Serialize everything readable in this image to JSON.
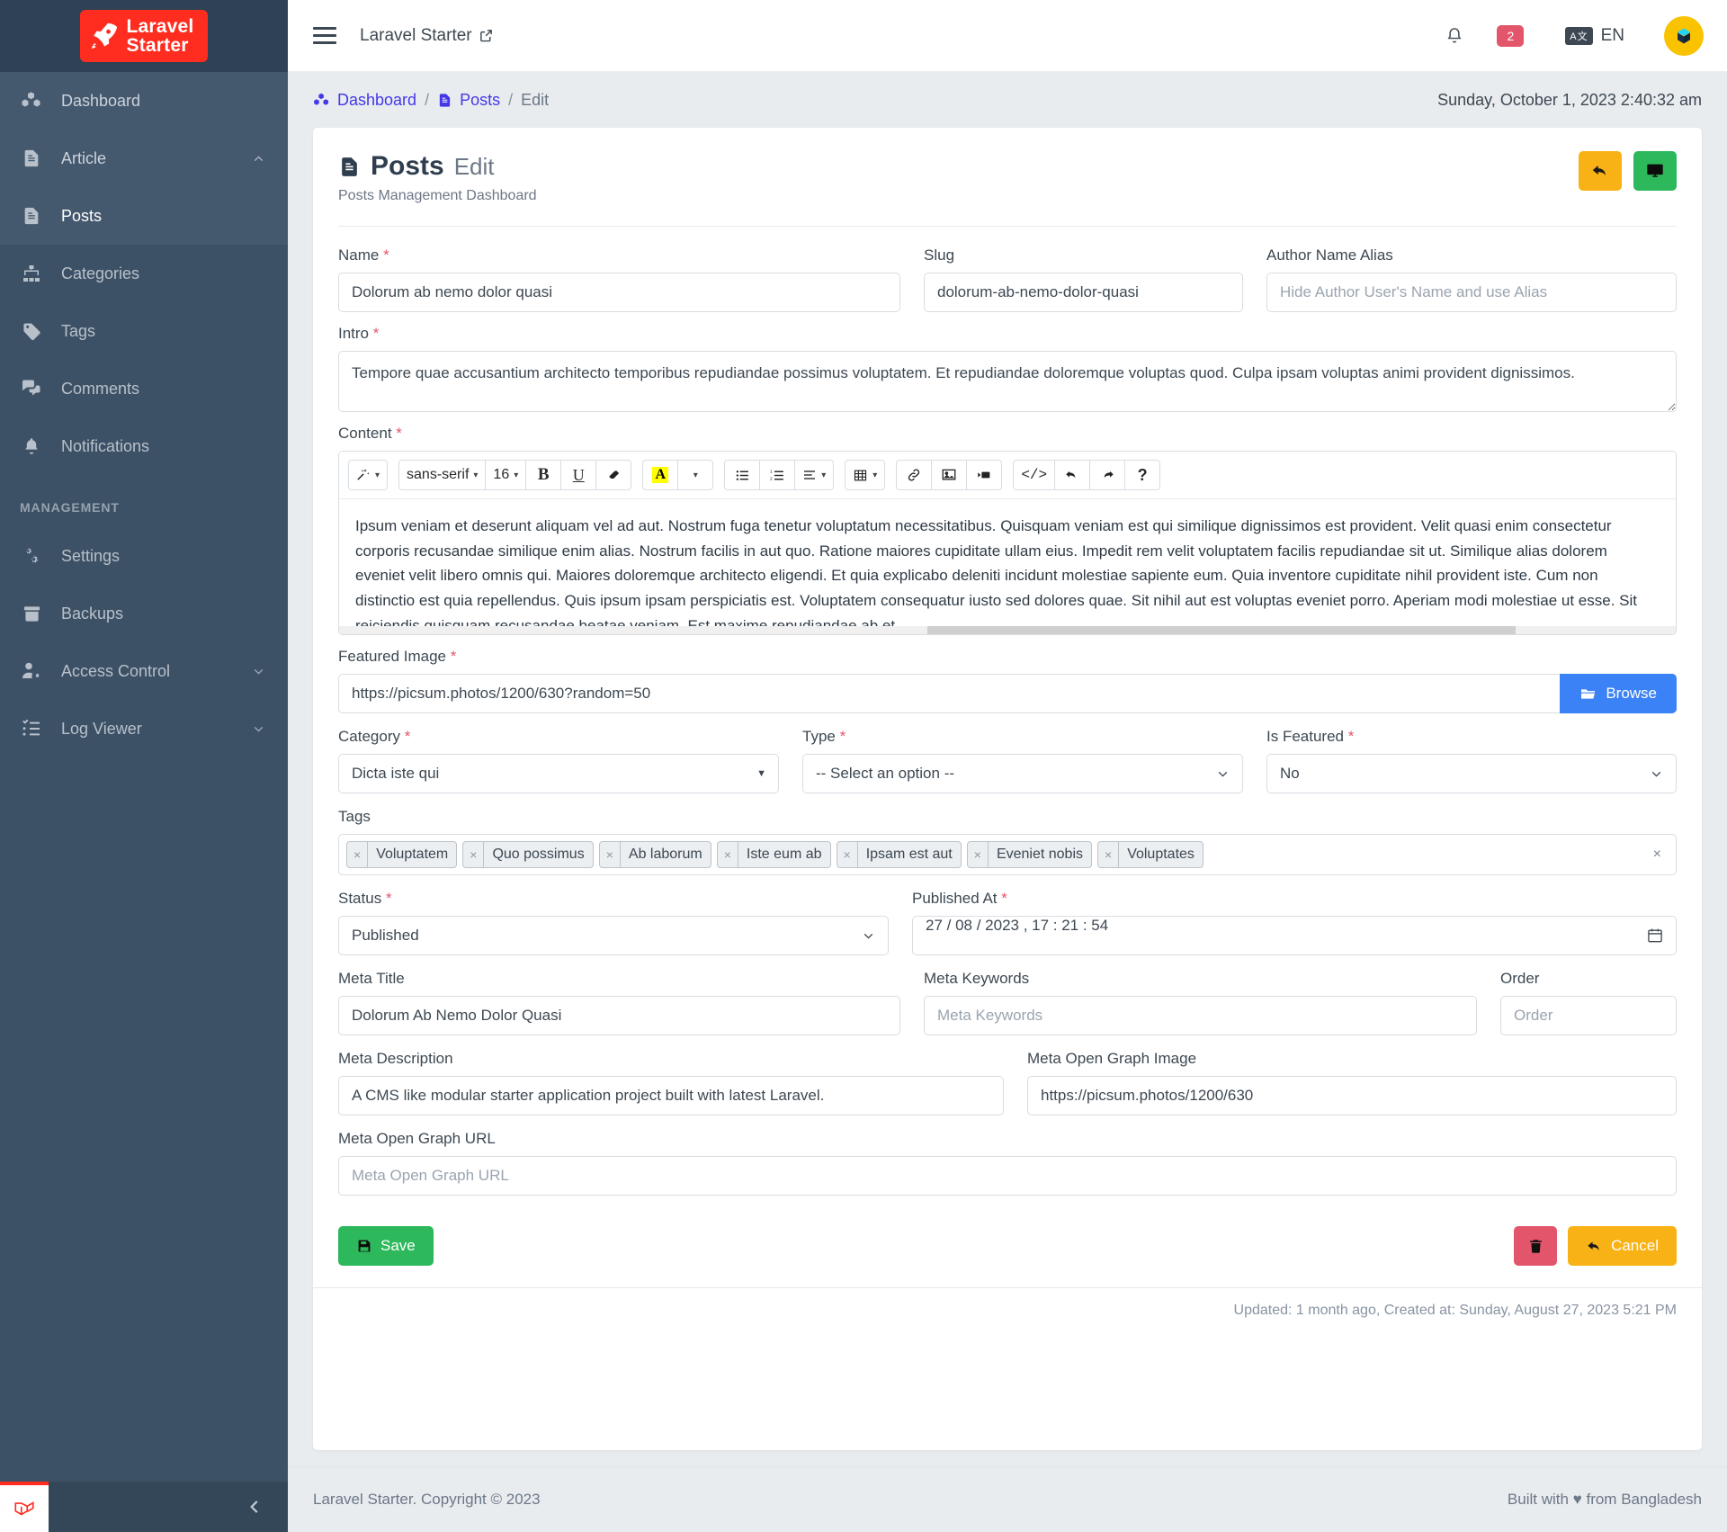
{
  "sidebar": {
    "brand": {
      "line1": "Laravel",
      "line2": "Starter",
      "logo_icon": "rocket-icon"
    },
    "items": [
      {
        "label": "Dashboard",
        "icon": "cubes-icon"
      },
      {
        "label": "Article",
        "icon": "document-icon",
        "chevron": "chevron-up-icon"
      },
      {
        "label": "Posts",
        "icon": "document-icon"
      },
      {
        "label": "Categories",
        "icon": "sitemap-icon"
      },
      {
        "label": "Tags",
        "icon": "tag-icon"
      },
      {
        "label": "Comments",
        "icon": "comments-icon"
      },
      {
        "label": "Notifications",
        "icon": "bell-icon"
      }
    ],
    "section_label": "MANAGEMENT",
    "management_items": [
      {
        "label": "Settings",
        "icon": "gears-icon"
      },
      {
        "label": "Backups",
        "icon": "archive-icon"
      },
      {
        "label": "Access Control",
        "icon": "user-gear-icon",
        "chevron": "chevron-down-icon"
      },
      {
        "label": "Log Viewer",
        "icon": "checklist-icon",
        "chevron": "chevron-down-icon"
      }
    ],
    "collapse_icon": "chevron-left-icon"
  },
  "topbar": {
    "menu_icon": "hamburger-icon",
    "title": "Laravel Starter",
    "external_icon": "external-link-icon",
    "bell_icon": "bell-icon",
    "notification_count": "2",
    "language_icon": "translate-icon",
    "language": "EN",
    "avatar_icon": "cube-avatar-icon"
  },
  "breadcrumb": {
    "dashboard": "Dashboard",
    "posts": "Posts",
    "current": "Edit",
    "separator": "/",
    "datetime": "Sunday, October 1, 2023 2:40:32 am",
    "dashboard_icon": "cubes-icon",
    "posts_icon": "document-icon"
  },
  "page": {
    "title": "Posts",
    "title_suffix": "Edit",
    "title_icon": "document-icon",
    "subtitle": "Posts Management Dashboard",
    "back_button_icon": "reply-arrow-icon",
    "view_button_icon": "monitor-icon"
  },
  "form": {
    "name": {
      "label": "Name",
      "required": true,
      "value": "Dolorum ab nemo dolor quasi"
    },
    "slug": {
      "label": "Slug",
      "required": false,
      "value": "dolorum-ab-nemo-dolor-quasi"
    },
    "author_alias": {
      "label": "Author Name Alias",
      "required": false,
      "value": "",
      "placeholder": "Hide Author User's Name and use Alias"
    },
    "intro": {
      "label": "Intro",
      "required": true,
      "value": "Tempore quae accusantium architecto temporibus repudiandae possimus voluptatem. Et repudiandae doloremque voluptas quod. Culpa ipsam voluptas animi provident dignissimos."
    },
    "content": {
      "label": "Content",
      "required": true,
      "value": "Ipsum veniam et deserunt aliquam vel ad aut. Nostrum fuga tenetur voluptatum necessitatibus. Quisquam veniam est qui similique dignissimos est provident. Velit quasi enim consectetur corporis recusandae similique enim alias. Nostrum facilis in aut quo. Ratione maiores cupiditate ullam eius. Impedit rem velit voluptatem facilis repudiandae sit ut. Similique alias dolorem eveniet velit libero omnis qui. Maiores doloremque architecto eligendi. Et quia explicabo deleniti incidunt molestiae sapiente eum. Quia inventore cupiditate nihil provident iste. Cum non distinctio est quia repellendus. Quis ipsum ipsam perspiciatis est. Voluptatem consequatur iusto sed dolores quae. Sit nihil aut est voluptas eveniet porro. Aperiam modi molestiae ut esse. Sit reiciendis quisquam recusandae beatae veniam. Est maxime repudiandae ab et"
    },
    "editor_toolbar": {
      "magic": {
        "icon": "magic-wand-icon",
        "caret": "▾"
      },
      "font_family": "sans-serif",
      "font_size": "16",
      "bold": "B",
      "underline": "U",
      "eraser_icon": "eraser-icon",
      "text_color": "A",
      "unordered_list_icon": "bullet-list-icon",
      "ordered_list_icon": "numbered-list-icon",
      "align_icon": "align-icon",
      "table_icon": "table-icon",
      "link_icon": "link-icon",
      "image_icon": "image-icon",
      "video_icon": "video-icon",
      "code_icon": "code-icon",
      "undo_icon": "undo-icon",
      "redo_icon": "redo-icon",
      "help_icon": "help-icon"
    },
    "featured_image": {
      "label": "Featured Image",
      "required": true,
      "value": "https://picsum.photos/1200/630?random=50",
      "browse_label": "Browse",
      "browse_icon": "folder-open-icon"
    },
    "category": {
      "label": "Category",
      "required": true,
      "value": "Dicta iste qui"
    },
    "type": {
      "label": "Type",
      "required": true,
      "value": "-- Select an option --"
    },
    "is_featured": {
      "label": "Is Featured",
      "required": true,
      "value": "No"
    },
    "tags": {
      "label": "Tags",
      "items": [
        "Voluptatem",
        "Quo possimus",
        "Ab laborum",
        "Iste eum ab",
        "Ipsam est aut",
        "Eveniet nobis",
        "Voluptates"
      ],
      "remove_glyph": "×",
      "clear_glyph": "×"
    },
    "status": {
      "label": "Status",
      "required": true,
      "value": "Published"
    },
    "published_at": {
      "label": "Published At",
      "required": true,
      "value": "27 / 08 / 2023 , 17 : 21 : 54",
      "calendar_icon": "calendar-icon"
    },
    "meta_title": {
      "label": "Meta Title",
      "value": "Dolorum Ab Nemo Dolor Quasi"
    },
    "meta_keywords": {
      "label": "Meta Keywords",
      "value": "",
      "placeholder": "Meta Keywords"
    },
    "order": {
      "label": "Order",
      "value": "",
      "placeholder": "Order"
    },
    "meta_description": {
      "label": "Meta Description",
      "value": "A CMS like modular starter application project built with latest Laravel."
    },
    "meta_og_image": {
      "label": "Meta Open Graph Image",
      "value": "https://picsum.photos/1200/630"
    },
    "meta_og_url": {
      "label": "Meta Open Graph URL",
      "value": "",
      "placeholder": "Meta Open Graph URL"
    }
  },
  "actions": {
    "save_label": "Save",
    "save_icon": "save-icon",
    "delete_icon": "trash-icon",
    "cancel_label": "Cancel",
    "cancel_icon": "reply-arrow-icon"
  },
  "card_footer": {
    "text": "Updated: 1 month ago, Created at: Sunday, August 27, 2023 5:21 PM"
  },
  "footer": {
    "left": "Laravel Starter. Copyright © 2023",
    "right": "Built with ♥ from Bangladesh"
  },
  "colors": {
    "sidebar_bg": "#3d5166",
    "brand_red": "#ff2d20",
    "accent_blue": "#4338e8",
    "success_green": "#2eb85c",
    "warning_amber": "#f9b215",
    "danger_red": "#e3556b",
    "browse_blue": "#3b82f6",
    "avatar_yellow": "#f9c300"
  }
}
